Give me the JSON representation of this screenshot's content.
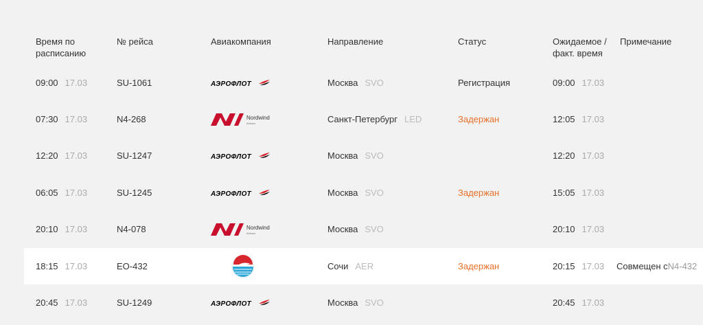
{
  "headers": {
    "scheduled": "Время по\nрасписанию",
    "flight": "№ рейса",
    "airline": "Авиакомпания",
    "direction": "Направление",
    "status": "Статус",
    "expected": "Ожидаемое /\nфакт. время",
    "note": "Примечание"
  },
  "airlines": {
    "aeroflot": "АЭРОФЛОТ",
    "nordwind": "Nordwind",
    "nordwind_sub": "Airlines"
  },
  "colors": {
    "delayed": "#e8702a",
    "aeroflot_blue": "#1a4c9c",
    "aeroflot_red": "#d7262d",
    "nordwind_red": "#c8102e"
  },
  "rows": [
    {
      "sched_time": "09:00",
      "sched_date": "17.03",
      "flight": "SU-1061",
      "airline": "aeroflot",
      "city": "Москва",
      "code": "SVO",
      "status": "Регистрация",
      "exp_time": "09:00",
      "exp_date": "17.03",
      "note": "",
      "note_flight": ""
    },
    {
      "sched_time": "07:30",
      "sched_date": "17.03",
      "flight": "N4-268",
      "airline": "nordwind",
      "city": "Санкт-Петербург",
      "code": "LED",
      "status": "Задержан",
      "exp_time": "12:05",
      "exp_date": "17.03",
      "note": "",
      "note_flight": ""
    },
    {
      "sched_time": "12:20",
      "sched_date": "17.03",
      "flight": "SU-1247",
      "airline": "aeroflot",
      "city": "Москва",
      "code": "SVO",
      "status": "",
      "exp_time": "12:20",
      "exp_date": "17.03",
      "note": "",
      "note_flight": ""
    },
    {
      "sched_time": "06:05",
      "sched_date": "17.03",
      "flight": "SU-1245",
      "airline": "aeroflot",
      "city": "Москва",
      "code": "SVO",
      "status": "Задержан",
      "exp_time": "15:05",
      "exp_date": "17.03",
      "note": "",
      "note_flight": ""
    },
    {
      "sched_time": "20:10",
      "sched_date": "17.03",
      "flight": "N4-078",
      "airline": "nordwind",
      "city": "Москва",
      "code": "SVO",
      "status": "",
      "exp_time": "20:10",
      "exp_date": "17.03",
      "note": "",
      "note_flight": ""
    },
    {
      "sched_time": "18:15",
      "sched_date": "17.03",
      "flight": "EO-432",
      "airline": "pegas",
      "city": "Сочи",
      "code": "AER",
      "status": "Задержан",
      "exp_time": "20:15",
      "exp_date": "17.03",
      "note": "Совмещен с ",
      "note_flight": "N4-432",
      "highlight": true
    },
    {
      "sched_time": "20:45",
      "sched_date": "17.03",
      "flight": "SU-1249",
      "airline": "aeroflot",
      "city": "Москва",
      "code": "SVO",
      "status": "",
      "exp_time": "20:45",
      "exp_date": "17.03",
      "note": "",
      "note_flight": ""
    }
  ]
}
